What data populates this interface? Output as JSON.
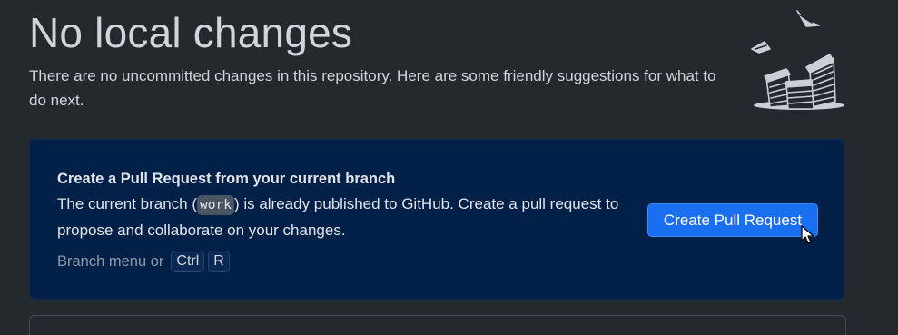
{
  "header": {
    "title": "No local changes",
    "subtitle": "There are no uncommitted changes in this repository. Here are some friendly suggestions for what to do next."
  },
  "illustration": {
    "icon": "papers-stack-illustration-icon"
  },
  "pull_request_card": {
    "title": "Create a Pull Request from your current branch",
    "body_before": "The current branch (",
    "branch": "work",
    "body_after": ") is already published to GitHub. Create a pull request to propose and collaborate on your changes.",
    "shortcut_label": "Branch menu or",
    "shortcut_keys": [
      "Ctrl",
      "R"
    ],
    "button_label": "Create Pull Request"
  },
  "colors": {
    "background": "#24292e",
    "card_background": "#032148",
    "button": "#1a6ef0"
  }
}
